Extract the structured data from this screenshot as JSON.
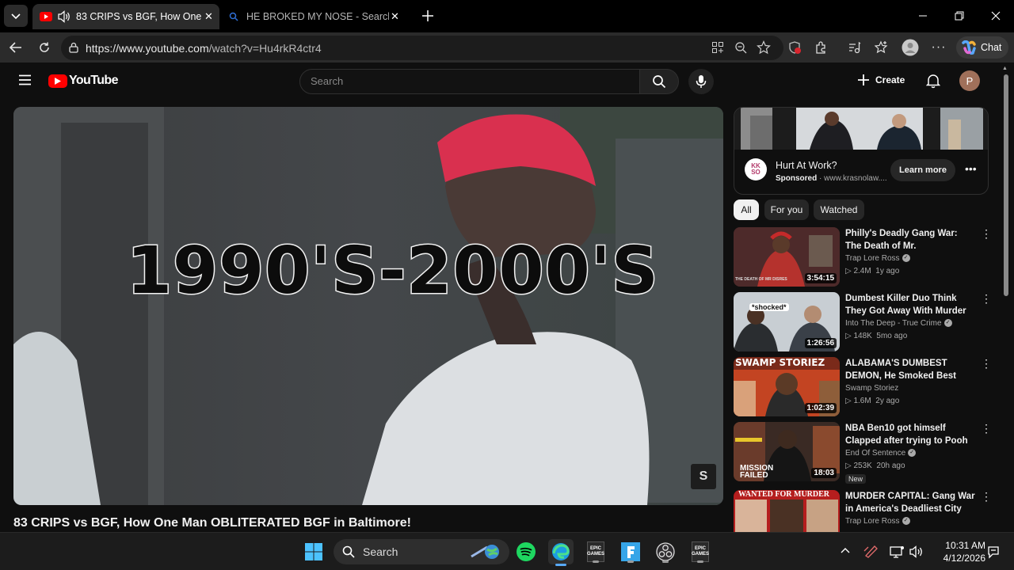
{
  "browser": {
    "tabs": [
      {
        "title": "83 CRIPS vs BGF, How One Ma",
        "active": true
      },
      {
        "title": "HE BROKED MY NOSE - Search",
        "active": false
      }
    ],
    "url": "https://www.youtube.com/watch?v=Hu4rkR4ctr4",
    "url_host": "https://www.youtube.com",
    "url_path": "/watch?v=Hu4rkR4ctr4",
    "chat_label": "Chat",
    "profile_initial": "P"
  },
  "youtube": {
    "logo_text": "YouTube",
    "search_placeholder": "Search",
    "create_label": "Create",
    "avatar_initial": "P",
    "video_overlay_text": "1990'S-2000'S",
    "watermark": "S",
    "video_title": "83 CRIPS vs BGF, How One Man OBLITERATED BGF in Baltimore!"
  },
  "ad": {
    "title": "Hurt At Work?",
    "sponsored": "Sponsored",
    "domain": "· www.krasnolaw....",
    "logo_text": "KK SO",
    "cta": "Learn more"
  },
  "chips": [
    "All",
    "For you",
    "Watched"
  ],
  "recommendations": [
    {
      "title": "Philly's Deadly Gang War: The Death of Mr. Disrespectful",
      "channel": "Trap Lore Ross",
      "views": "2.4M",
      "age": "1y ago",
      "duration": "3:54:15",
      "thumb_text": "THE DEATH OF MR DISRES",
      "badge": ""
    },
    {
      "title": "Dumbest Killer Duo Think They Got Away With Murder (They ...",
      "channel": "Into The Deep - True Crime",
      "views": "148K",
      "age": "5mo ago",
      "duration": "1:26:56",
      "thumb_text": "*shocked*",
      "badge": ""
    },
    {
      "title": "ALABAMA'S DUMBEST DEMON, He Smoked Best Friend and Hi...",
      "channel": "Swamp Storiez",
      "views": "1.6M",
      "age": "2y ago",
      "duration": "1:02:39",
      "thumb_text": "SWAMP STORIEZ",
      "badge": ""
    },
    {
      "title": "NBA Ben10 got himself Clapped after trying to Pooh Shiesty a ...",
      "channel": "End Of Sentence",
      "views": "253K",
      "age": "20h ago",
      "duration": "18:03",
      "thumb_text": "MISSION FAILED",
      "badge": "New"
    },
    {
      "title": "MURDER CAPITAL: Gang War in America's Deadliest City",
      "channel": "Trap Lore Ross",
      "views": "",
      "age": "",
      "duration": "",
      "thumb_text": "WANTED FOR MURDER",
      "badge": ""
    }
  ],
  "taskbar": {
    "search_label": "Search",
    "time": "10:31 AM",
    "date": "4/12/2026",
    "epic_label": "EPIC GAMES"
  },
  "colors": {
    "youtube_red": "#ff0000",
    "hat_pink": "#d9304f",
    "chip_active_bg": "#f1f1f1",
    "chip_bg": "#272727"
  }
}
